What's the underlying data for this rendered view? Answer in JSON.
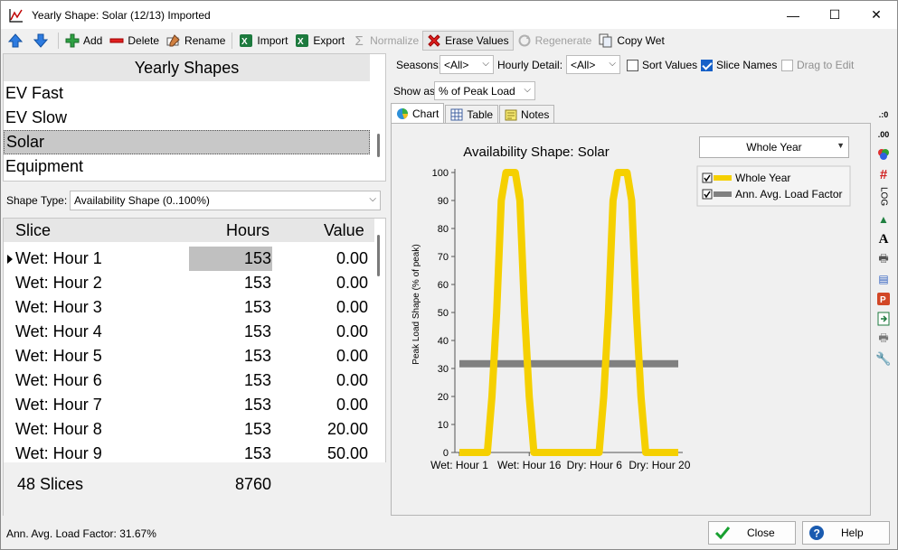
{
  "window": {
    "title": "Yearly Shape: Solar (12/13) Imported",
    "minimize_glyph": "—",
    "maximize_glyph": "☐",
    "close_glyph": "✕"
  },
  "toolbar": {
    "add": "Add",
    "delete": "Delete",
    "rename": "Rename",
    "import": "Import",
    "export": "Export",
    "normalize": "Normalize",
    "erase_values": "Erase Values",
    "regenerate": "Regenerate",
    "copy_wet": "Copy Wet"
  },
  "shapes": {
    "header": "Yearly Shapes",
    "items": [
      "EV Fast",
      "EV Slow",
      "Solar",
      "Equipment"
    ],
    "selected": "Solar"
  },
  "shape_type": {
    "label": "Shape Type:",
    "value": "Availability Shape (0..100%)"
  },
  "grid": {
    "headers": {
      "slice": "Slice",
      "hours": "Hours",
      "value": "Value"
    },
    "rows": [
      {
        "slice": "Wet: Hour 1",
        "hours": "153",
        "value": "0.00"
      },
      {
        "slice": "Wet: Hour 2",
        "hours": "153",
        "value": "0.00"
      },
      {
        "slice": "Wet: Hour 3",
        "hours": "153",
        "value": "0.00"
      },
      {
        "slice": "Wet: Hour 4",
        "hours": "153",
        "value": "0.00"
      },
      {
        "slice": "Wet: Hour 5",
        "hours": "153",
        "value": "0.00"
      },
      {
        "slice": "Wet: Hour 6",
        "hours": "153",
        "value": "0.00"
      },
      {
        "slice": "Wet: Hour 7",
        "hours": "153",
        "value": "0.00"
      },
      {
        "slice": "Wet: Hour 8",
        "hours": "153",
        "value": "20.00"
      },
      {
        "slice": "Wet: Hour 9",
        "hours": "153",
        "value": "50.00"
      }
    ],
    "footer": {
      "slices": "48 Slices",
      "total_hours": "8760"
    }
  },
  "options": {
    "seasons_label": "Seasons:",
    "seasons_value": "<All>",
    "hourly_label": "Hourly Detail:",
    "hourly_value": "<All>",
    "sort_values": "Sort Values",
    "slice_names": "Slice Names",
    "drag_to_edit": "Drag to Edit",
    "show_as_label": "Show as:",
    "show_as_value": "% of Peak Load"
  },
  "tabs": {
    "chart": "Chart",
    "table": "Table",
    "notes": "Notes"
  },
  "chart_data": {
    "type": "line",
    "title": "Availability Shape: Solar",
    "ylabel": "Peak Load Shape (% of peak)",
    "xlabel": "",
    "ylim": [
      0,
      100
    ],
    "yticks": [
      0,
      10,
      20,
      30,
      40,
      50,
      60,
      70,
      80,
      90,
      100
    ],
    "x_tick_labels": [
      "Wet: Hour 1",
      "Wet: Hour 16",
      "Dry: Hour 6",
      "Dry: Hour 20"
    ],
    "series": [
      {
        "name": "Whole Year",
        "color": "#f5d000",
        "values": [
          0,
          0,
          0,
          0,
          0,
          0,
          0,
          20,
          50,
          90,
          100,
          100,
          100,
          90,
          50,
          20,
          0,
          0,
          0,
          0,
          0,
          0,
          0,
          0,
          0,
          0,
          0,
          0,
          0,
          0,
          0,
          20,
          50,
          90,
          100,
          100,
          100,
          90,
          50,
          20,
          0,
          0,
          0,
          0,
          0,
          0,
          0,
          0
        ]
      },
      {
        "name": "Ann. Avg. Load Factor",
        "color": "#808080",
        "values": [
          31.67,
          31.67,
          31.67,
          31.67,
          31.67,
          31.67,
          31.67,
          31.67,
          31.67,
          31.67,
          31.67,
          31.67,
          31.67,
          31.67,
          31.67,
          31.67,
          31.67,
          31.67,
          31.67,
          31.67,
          31.67,
          31.67,
          31.67,
          31.67,
          31.67,
          31.67,
          31.67,
          31.67,
          31.67,
          31.67,
          31.67,
          31.67,
          31.67,
          31.67,
          31.67,
          31.67,
          31.67,
          31.67,
          31.67,
          31.67,
          31.67,
          31.67,
          31.67,
          31.67,
          31.67,
          31.67,
          31.67,
          31.67
        ]
      }
    ],
    "legend_position": "top-right",
    "period_selector": "Whole Year"
  },
  "status": {
    "text": "Ann. Avg. Load Factor: 31.67%",
    "close_button": "Close",
    "help_button": "Help"
  },
  "side_icons": {
    "log_label": "LOG"
  }
}
